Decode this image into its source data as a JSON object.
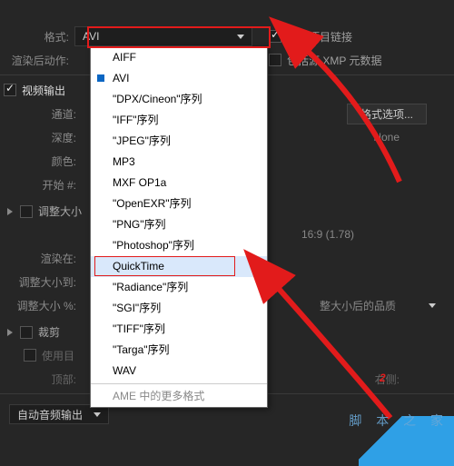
{
  "format": {
    "label": "格式:",
    "selected": "AVI",
    "options": [
      "AIFF",
      "AVI",
      "\"DPX/Cineon\"序列",
      "\"IFF\"序列",
      "\"JPEG\"序列",
      "MP3",
      "MXF OP1a",
      "\"OpenEXR\"序列",
      "\"PNG\"序列",
      "\"Photoshop\"序列",
      "QuickTime",
      "\"Radiance\"序列",
      "\"SGI\"序列",
      "\"TIFF\"序列",
      "\"Targa\"序列",
      "WAV"
    ],
    "selected_index": 1,
    "highlighted_index": 10,
    "more": "AME 中的更多格式"
  },
  "post_render": {
    "label": "渲染后动作:"
  },
  "include_link": {
    "label": "包括项目链接",
    "checked": true
  },
  "include_source": {
    "label": "包括源 XMP 元数据"
  },
  "video_out": {
    "label": "视频输出",
    "checked": true
  },
  "channel": {
    "label": "通道:"
  },
  "format_options_btn": "格式选项...",
  "depth": {
    "label": "深度:"
  },
  "depth_right": "None",
  "color": {
    "label": "颜色:"
  },
  "start": {
    "label": "开始 #:"
  },
  "resize": {
    "header": "调整大小",
    "aspect": "16:9 (1.78)",
    "at": "渲染在:",
    "to": "调整大小到:",
    "pct": "调整大小 %:",
    "quality": "整大小后的品质"
  },
  "crop": {
    "header": "裁剪",
    "use_target": "使用目",
    "top": "顶部:",
    "right": "右侧:"
  },
  "audio": "自动音频输出",
  "annotation_2": "2",
  "watermark": "脚 本 之 家",
  "colors": {
    "red": "#e21b1b"
  }
}
